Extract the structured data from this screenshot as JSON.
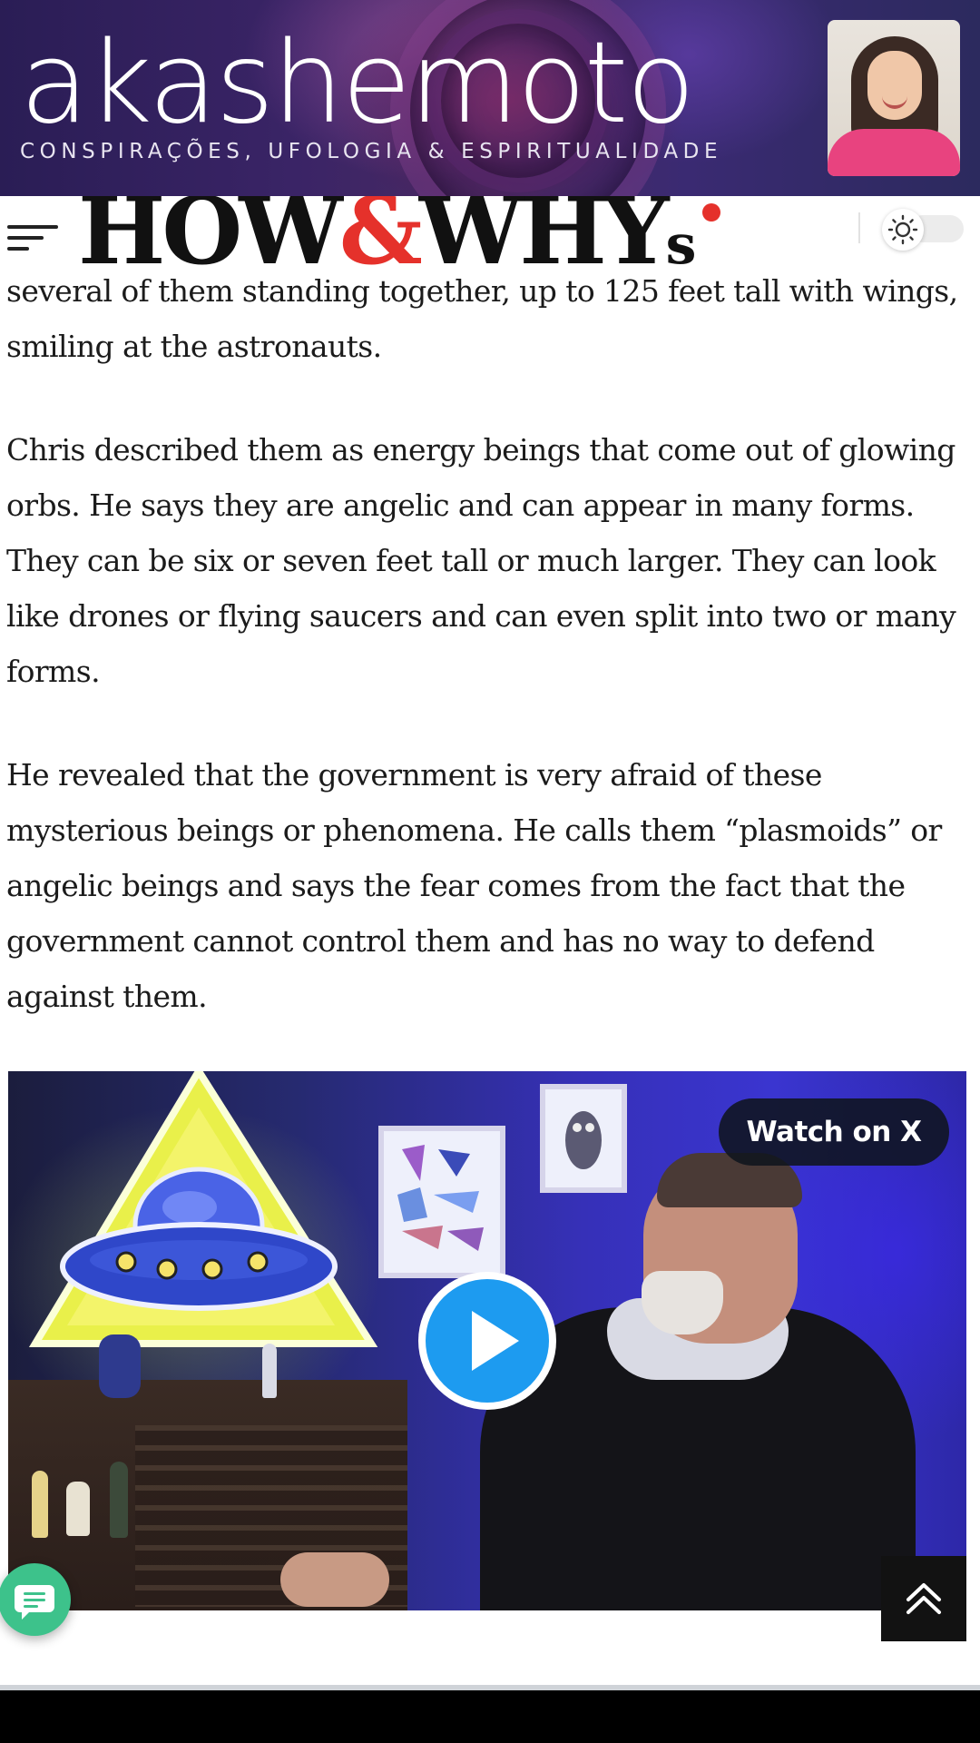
{
  "banner": {
    "logo_text": "akashemoto",
    "tagline": "CONSPIRAÇÕES, UFOLOGIA & ESPIRITUALIDADE",
    "background_color": "#3a2466"
  },
  "header": {
    "logo_part1": "HOW",
    "logo_amp": "&",
    "logo_part2": "WHY",
    "logo_s": "s",
    "accent_color": "#e5312b",
    "menu_icon": "hamburger-menu-icon",
    "theme_icon": "sun-icon"
  },
  "article": {
    "paragraphs": [
      "several of them standing together, up to 125 feet tall with wings, smiling at the astronauts.",
      "Chris described them as energy beings that come out of glowing orbs. He says they are angelic and can appear in many forms. They can be six or seven feet tall or much larger. They can look like drones or flying saucers and can even split into two or many forms.",
      "He revealed that the government is very afraid of these mysterious beings or phenomena. He calls them “plasmoids” or angelic beings and says the fear comes from the fact that the government cannot control them and has no way to defend against them."
    ]
  },
  "video": {
    "watch_label": "Watch on X",
    "play_icon": "play-icon",
    "play_color": "#1d9bf0"
  },
  "fabs": {
    "chat_icon": "chat-bubble-icon",
    "chat_color": "#3dc28b",
    "back_to_top_icon": "double-chevron-up-icon"
  }
}
